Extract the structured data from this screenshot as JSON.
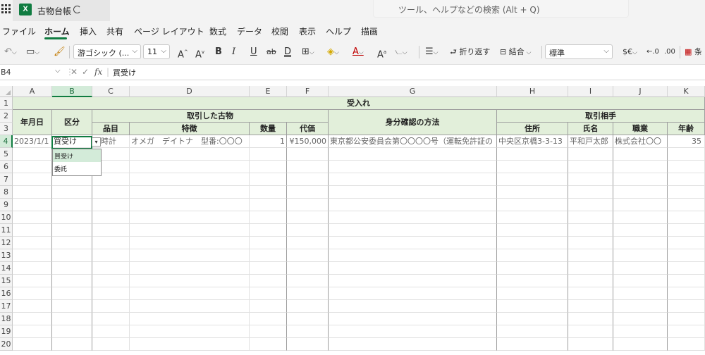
{
  "titlebar": {
    "doc_title": "古物台帳",
    "search_placeholder": "ツール、ヘルプなどの検索 (Alt + Q)"
  },
  "menu": {
    "tabs": [
      {
        "label": "ファイル"
      },
      {
        "label": "ホーム",
        "active": true
      },
      {
        "label": "挿入"
      },
      {
        "label": "共有"
      },
      {
        "label": "ページ レイアウト"
      },
      {
        "label": "数式"
      },
      {
        "label": "データ"
      },
      {
        "label": "校閲"
      },
      {
        "label": "表示"
      },
      {
        "label": "ヘルプ"
      },
      {
        "label": "描画"
      }
    ]
  },
  "toolbar": {
    "font_name": "游ゴシック (...",
    "font_size": "11",
    "wrap_text": "折り返す",
    "merge": "結合",
    "number_format": "標準",
    "conditional": "条"
  },
  "formula_bar": {
    "name_box": "B4",
    "value": "買受け"
  },
  "grid": {
    "columns": [
      "A",
      "B",
      "C",
      "D",
      "E",
      "F",
      "G",
      "H",
      "I",
      "J",
      "K"
    ],
    "rows": [
      "1",
      "2",
      "3",
      "4",
      "5",
      "6",
      "7",
      "8",
      "9",
      "10",
      "11",
      "12",
      "13",
      "14",
      "15",
      "16",
      "17",
      "18",
      "19",
      "20"
    ],
    "headers": {
      "ukeire": "受入れ",
      "date": "年月日",
      "kubun": "区分",
      "goods": "取引した古物",
      "item": "品目",
      "features": "特徴",
      "qty": "数量",
      "price": "代価",
      "id_method": "身分確認の方法",
      "partner": "取引相手",
      "address": "住所",
      "name": "氏名",
      "job": "職業",
      "age": "年齢"
    },
    "row4": {
      "date": "2023/1/1",
      "kubun": "買受け",
      "item": "時計",
      "features": "オメガ　デイトナ　型番:〇〇〇",
      "qty": "1",
      "price": "¥150,000",
      "id_method": "東京都公安委員会第〇〇〇〇号（運転免許証の",
      "address": "中央区京橋3-3-13",
      "name": "平和戸太郎",
      "job": "株式会社〇〇",
      "age": "35"
    },
    "dropdown_options": [
      "買受け",
      "委託"
    ]
  }
}
